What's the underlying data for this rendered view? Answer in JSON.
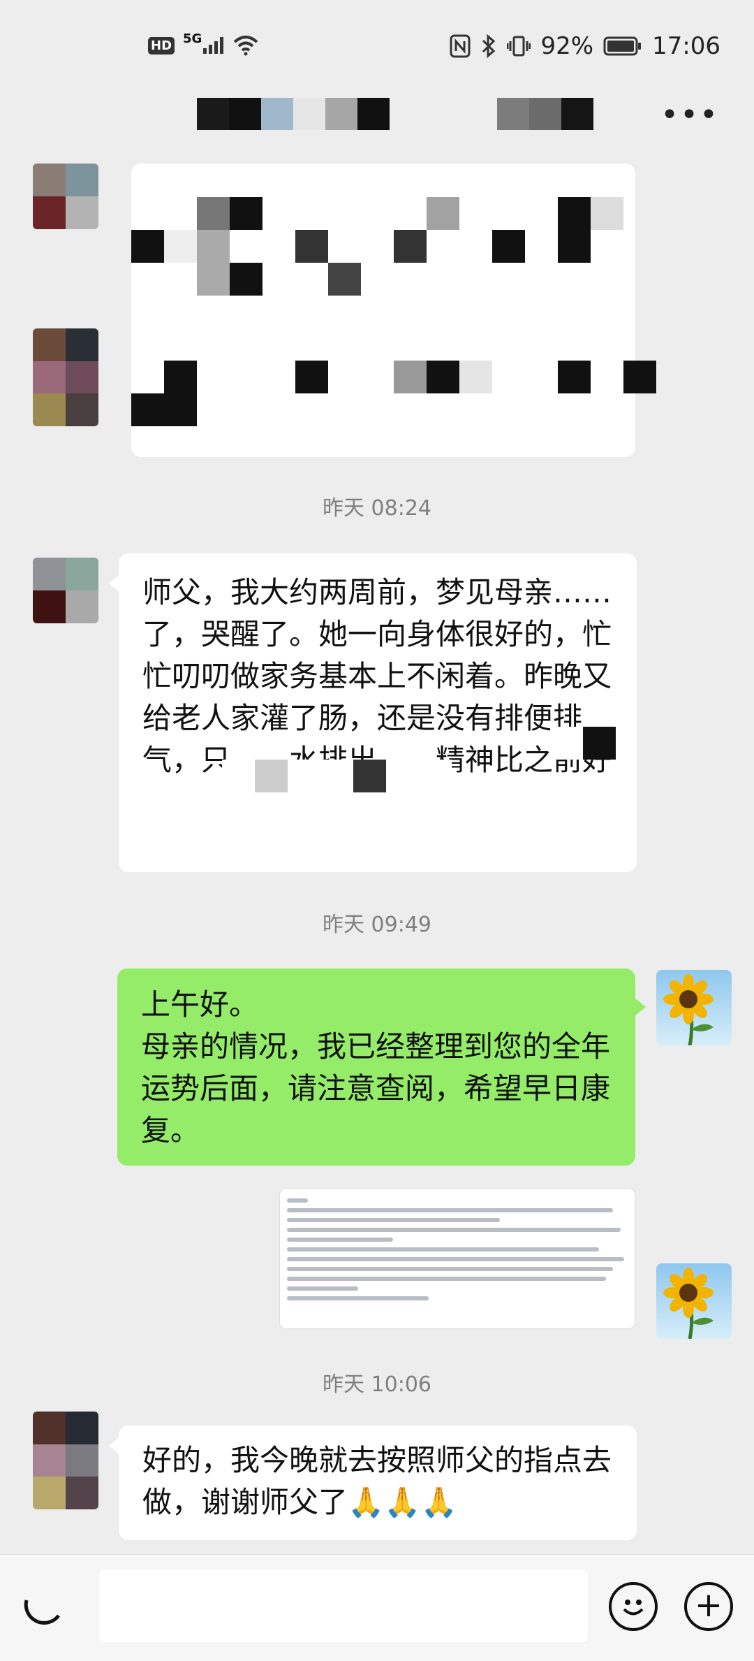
{
  "status_bar": {
    "network_badge": "HD",
    "network_type": "5G",
    "battery_percent": "92%",
    "clock": "17:06",
    "icons": [
      "hd-icon",
      "signal-icon",
      "wifi-icon",
      "nfc-icon",
      "bluetooth-icon",
      "vibrate-icon",
      "battery-icon"
    ]
  },
  "header": {
    "more_label": "•••"
  },
  "timestamps": {
    "t1": "昨天 08:24",
    "t2": "昨天 09:49",
    "t3": "昨天 10:06"
  },
  "messages": {
    "m1_text": "师父，我大约两周前，梦见母亲……了，哭醒了。她一向身体很好的，忙忙叨叨做家务基本上不闲着。昨晚又给老人家灌了肠，还是没有排便排气，只……水排出……精神比之前好",
    "m2_text": "上午好。\n母亲的情况，我已经整理到您的全年运势后面，请注意查阅，希望早日康复。",
    "m4_text": "好的，我今晚就去按照师父的指点去做，谢谢师父了🙏🙏🙏"
  },
  "colors": {
    "chat_bg": "#ededed",
    "self_bubble": "#95ec69",
    "other_bubble": "#ffffff",
    "timestamp_text": "#7f7f7f"
  },
  "bottom_bar": {
    "icons": [
      "voice-icon",
      "emoji-icon",
      "add-icon"
    ],
    "add_label": "+"
  }
}
